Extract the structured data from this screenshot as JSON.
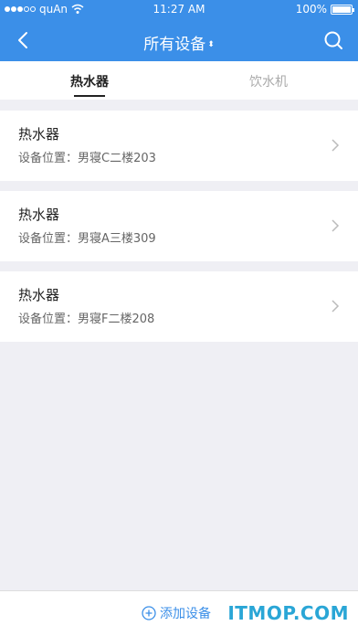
{
  "status_bar": {
    "carrier": "quAn",
    "time": "11:27 AM",
    "battery": "100%"
  },
  "nav": {
    "title": "所有设备",
    "sort_glyph": "⬍"
  },
  "tabs": [
    {
      "label": "热水器",
      "active": true
    },
    {
      "label": "饮水机",
      "active": false
    }
  ],
  "devices": [
    {
      "name": "热水器",
      "location": "设备位置：男寝C二楼203"
    },
    {
      "name": "热水器",
      "location": "设备位置：男寝A三楼309"
    },
    {
      "name": "热水器",
      "location": "设备位置：男寝F二楼208"
    }
  ],
  "bottom": {
    "add_label": "添加设备"
  },
  "watermark": "ITMOP.COM",
  "colors": {
    "primary": "#3b8fe8",
    "background": "#efeff4"
  }
}
